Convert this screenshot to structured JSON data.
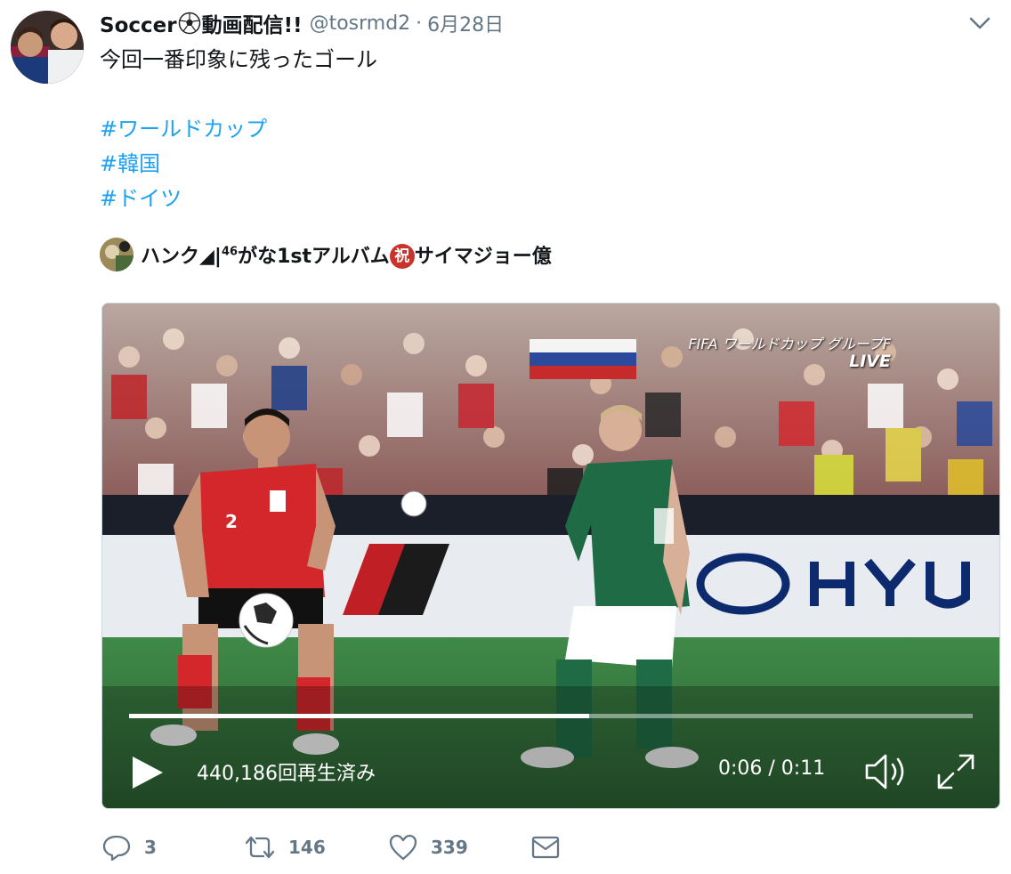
{
  "tweet": {
    "display_name_part1": "Soccer",
    "display_name_part2": "動画配信!!",
    "handle": "@tosrmd2",
    "separator": "·",
    "date": "6月28日",
    "text": "今回一番印象に残ったゴール",
    "hashtags": [
      "#ワールドカップ",
      "#韓国",
      "#ドイツ"
    ]
  },
  "embed": {
    "name_part1": "ハンク◢",
    "name_part2": "|",
    "superscript": "46",
    "name_part3": "がな1stアルバム",
    "badge": "祝",
    "name_part4": "サイマジョー億"
  },
  "video": {
    "overlay_title": "FIFA ワールドカップ グループF",
    "overlay_live": "LIVE",
    "progress": 0.545,
    "views": "440,186回再生済み",
    "time": "0:06 / 0:11",
    "player_number": "2"
  },
  "actions": {
    "reply_count": "3",
    "retweet_count": "146",
    "like_count": "339"
  },
  "colors": {
    "link": "#1da1f2",
    "secondary_text": "#657786",
    "korea_red": "#d3272b",
    "germany_green": "#1f6b45"
  },
  "icons": [
    "caret-down-icon",
    "soccer-ball-icon",
    "play-icon",
    "volume-icon",
    "fullscreen-icon",
    "reply-icon",
    "retweet-icon",
    "like-icon",
    "direct-message-icon"
  ]
}
